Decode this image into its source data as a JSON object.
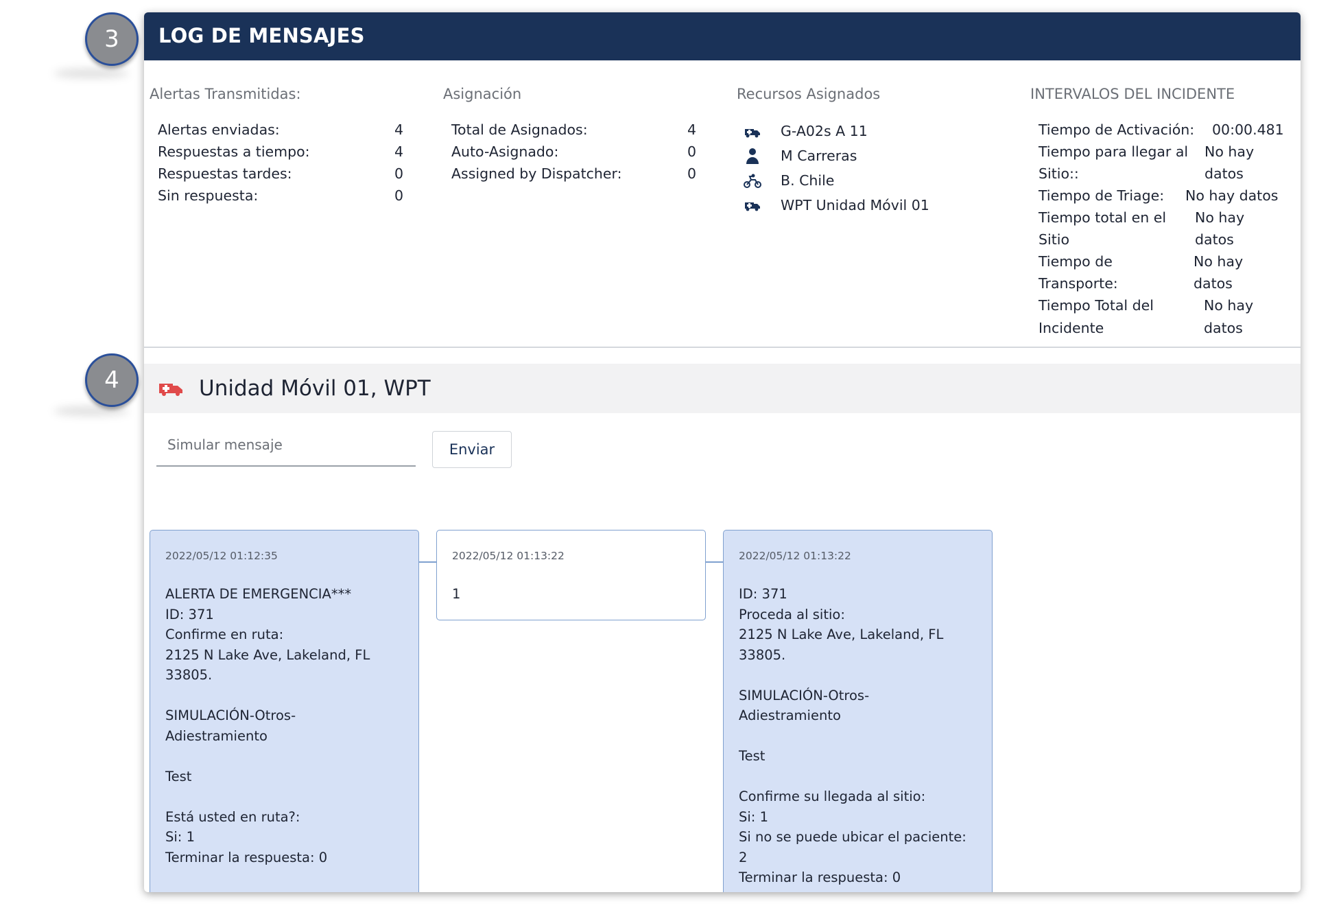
{
  "header": {
    "title": "LOG DE MENSAJES"
  },
  "badges": {
    "section3": "3",
    "section4": "4"
  },
  "alerts": {
    "heading": "Alertas Transmitidas:",
    "rows": [
      {
        "label": "Alertas enviadas:",
        "value": "4"
      },
      {
        "label": "Respuestas a tiempo:",
        "value": "4"
      },
      {
        "label": "Respuestas tardes:",
        "value": "0"
      },
      {
        "label": "Sin respuesta:",
        "value": "0"
      }
    ]
  },
  "assignment": {
    "heading": "Asignación",
    "rows": [
      {
        "label": "Total de Asignados:",
        "value": "4"
      },
      {
        "label": "Auto-Asignado:",
        "value": "0"
      },
      {
        "label": "Assigned by Dispatcher:",
        "value": "0"
      }
    ]
  },
  "resources": {
    "heading": "Recursos Asignados",
    "items": [
      {
        "icon": "ambulance-icon",
        "name": "G-A02s A 11"
      },
      {
        "icon": "person-icon",
        "name": "M Carreras"
      },
      {
        "icon": "motorcycle-icon",
        "name": "B. Chile"
      },
      {
        "icon": "ambulance-icon",
        "name": "WPT Unidad Móvil 01"
      }
    ]
  },
  "intervals": {
    "heading": "INTERVALOS DEL INCIDENTE",
    "lines": [
      {
        "label": "Tiempo de Activación:",
        "value": "00:00.481"
      },
      {
        "label": "Tiempo para llegar al",
        "value": "No hay"
      },
      {
        "label": "Sitio::",
        "value": "datos"
      },
      {
        "label": "Tiempo de Triage:",
        "value": "No hay datos"
      },
      {
        "label": "Tiempo total en el",
        "value": "No hay"
      },
      {
        "label": "Sitio",
        "value": "datos"
      },
      {
        "label": "Tiempo de",
        "value": "No hay"
      },
      {
        "label": "Transporte:",
        "value": "datos"
      },
      {
        "label": "Tiempo Total del",
        "value": "No hay"
      },
      {
        "label": "Incidente",
        "value": "datos"
      }
    ]
  },
  "unit": {
    "name": "Unidad Móvil 01, WPT",
    "icon": "ambulance-icon",
    "icon_color": "#e04a4a"
  },
  "composer": {
    "placeholder": "Simular mensaje",
    "send_label": "Enviar"
  },
  "messages": [
    {
      "timestamp": "2022/05/12 01:12:35",
      "style": "incoming",
      "body": "ALERTA DE EMERGENCIA***\nID: 371\nConfirme en ruta:\n2125 N Lake Ave, Lakeland, FL\n33805.\n\nSIMULACIÓN-Otros-\nAdiestramiento\n\nTest\n\nEstá usted en ruta?:\nSi: 1\nTerminar la respuesta: 0"
    },
    {
      "timestamp": "2022/05/12 01:13:22",
      "style": "outgoing",
      "body": "1"
    },
    {
      "timestamp": "2022/05/12 01:13:22",
      "style": "incoming",
      "body": "ID: 371\nProceda al sitio:\n2125 N Lake Ave, Lakeland, FL\n33805.\n\nSIMULACIÓN-Otros-\nAdiestramiento\n\nTest\n\nConfirme su llegada al sitio:\nSi: 1\nSi no se puede ubicar el paciente:\n2\nTerminar la respuesta: 0"
    }
  ],
  "colors": {
    "header_bg": "#1a3258",
    "bubble_bg": "#d6e1f6",
    "bubble_border": "#7fa0cf",
    "icon_navy": "#1a3258"
  }
}
